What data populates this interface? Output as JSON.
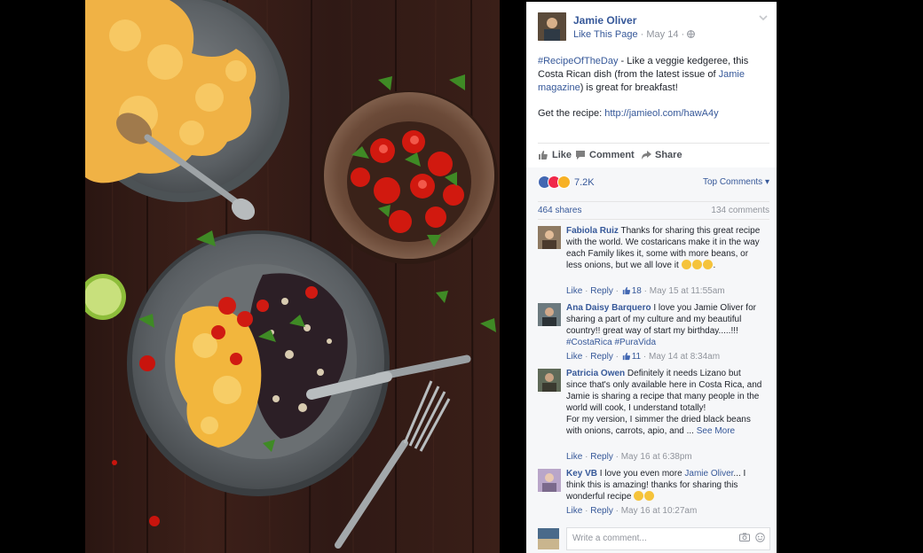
{
  "post": {
    "page_name": "Jamie Oliver",
    "like_page": "Like This Page",
    "date": "May 14",
    "text_hashtag": "#RecipeOfTheDay",
    "text_1": " - Like a veggie kedgeree, this Costa Rican dish (from the latest issue of ",
    "text_mag": "Jamie magazine",
    "text_2": ") is great for breakfast!",
    "recipe_label": "Get the recipe: ",
    "recipe_link": "http://jamieol.com/hawA4y"
  },
  "actions": {
    "like": "Like",
    "comment": "Comment",
    "share": "Share"
  },
  "stats": {
    "reactions": "7.2K",
    "top_comments": "Top Comments",
    "shares": "464 shares",
    "comments": "134 comments"
  },
  "comments": [
    {
      "name": "Fabiola Ruiz",
      "text": "Thanks for sharing this great recipe with the world. We costaricans make it in the way each Family likes it, some with more beans, or less onions, but we all love it",
      "like": "Like",
      "reply": "Reply",
      "likes": "18",
      "time": "May 15 at 11:55am"
    },
    {
      "name": "Ana Daisy Barquero",
      "text": "I love you Jamie Oliver for sharing a part of my culture and my beautiful country!! great way of start my birthday.....!!! ",
      "tag1": "#CostaRica",
      "tag2": "#PuraVida",
      "like": "Like",
      "reply": "Reply",
      "likes": "11",
      "time": "May 14 at 8:34am"
    },
    {
      "name": "Patricia Owen",
      "text": "Definitely it needs Lizano but since that's only available here in Costa Rica, and Jamie is sharing a recipe that many people in the world will cook, I understand totally!",
      "text2": "For my version, I simmer the dried black beans with onions, carrots, apio, and ...",
      "see_more": "See More",
      "like": "Like",
      "reply": "Reply",
      "time": "May 16 at 6:38pm"
    },
    {
      "name": "Key VB",
      "text": "I love you even more ",
      "mention": "Jamie Oliver",
      "text2": "... I think this is amazing! thanks for sharing this wonderful recipe",
      "like": "Like",
      "reply": "Reply",
      "time": "May 16 at 10:27am"
    }
  ],
  "write": {
    "placeholder": "Write a comment..."
  },
  "colors": {
    "link": "#365899",
    "meta": "#90949c",
    "panel_bg": "#f6f7f9"
  },
  "icons": [
    "chevron-down-icon",
    "globe-icon",
    "like-icon",
    "comment-icon",
    "share-icon",
    "camera-icon",
    "smiley-icon"
  ]
}
